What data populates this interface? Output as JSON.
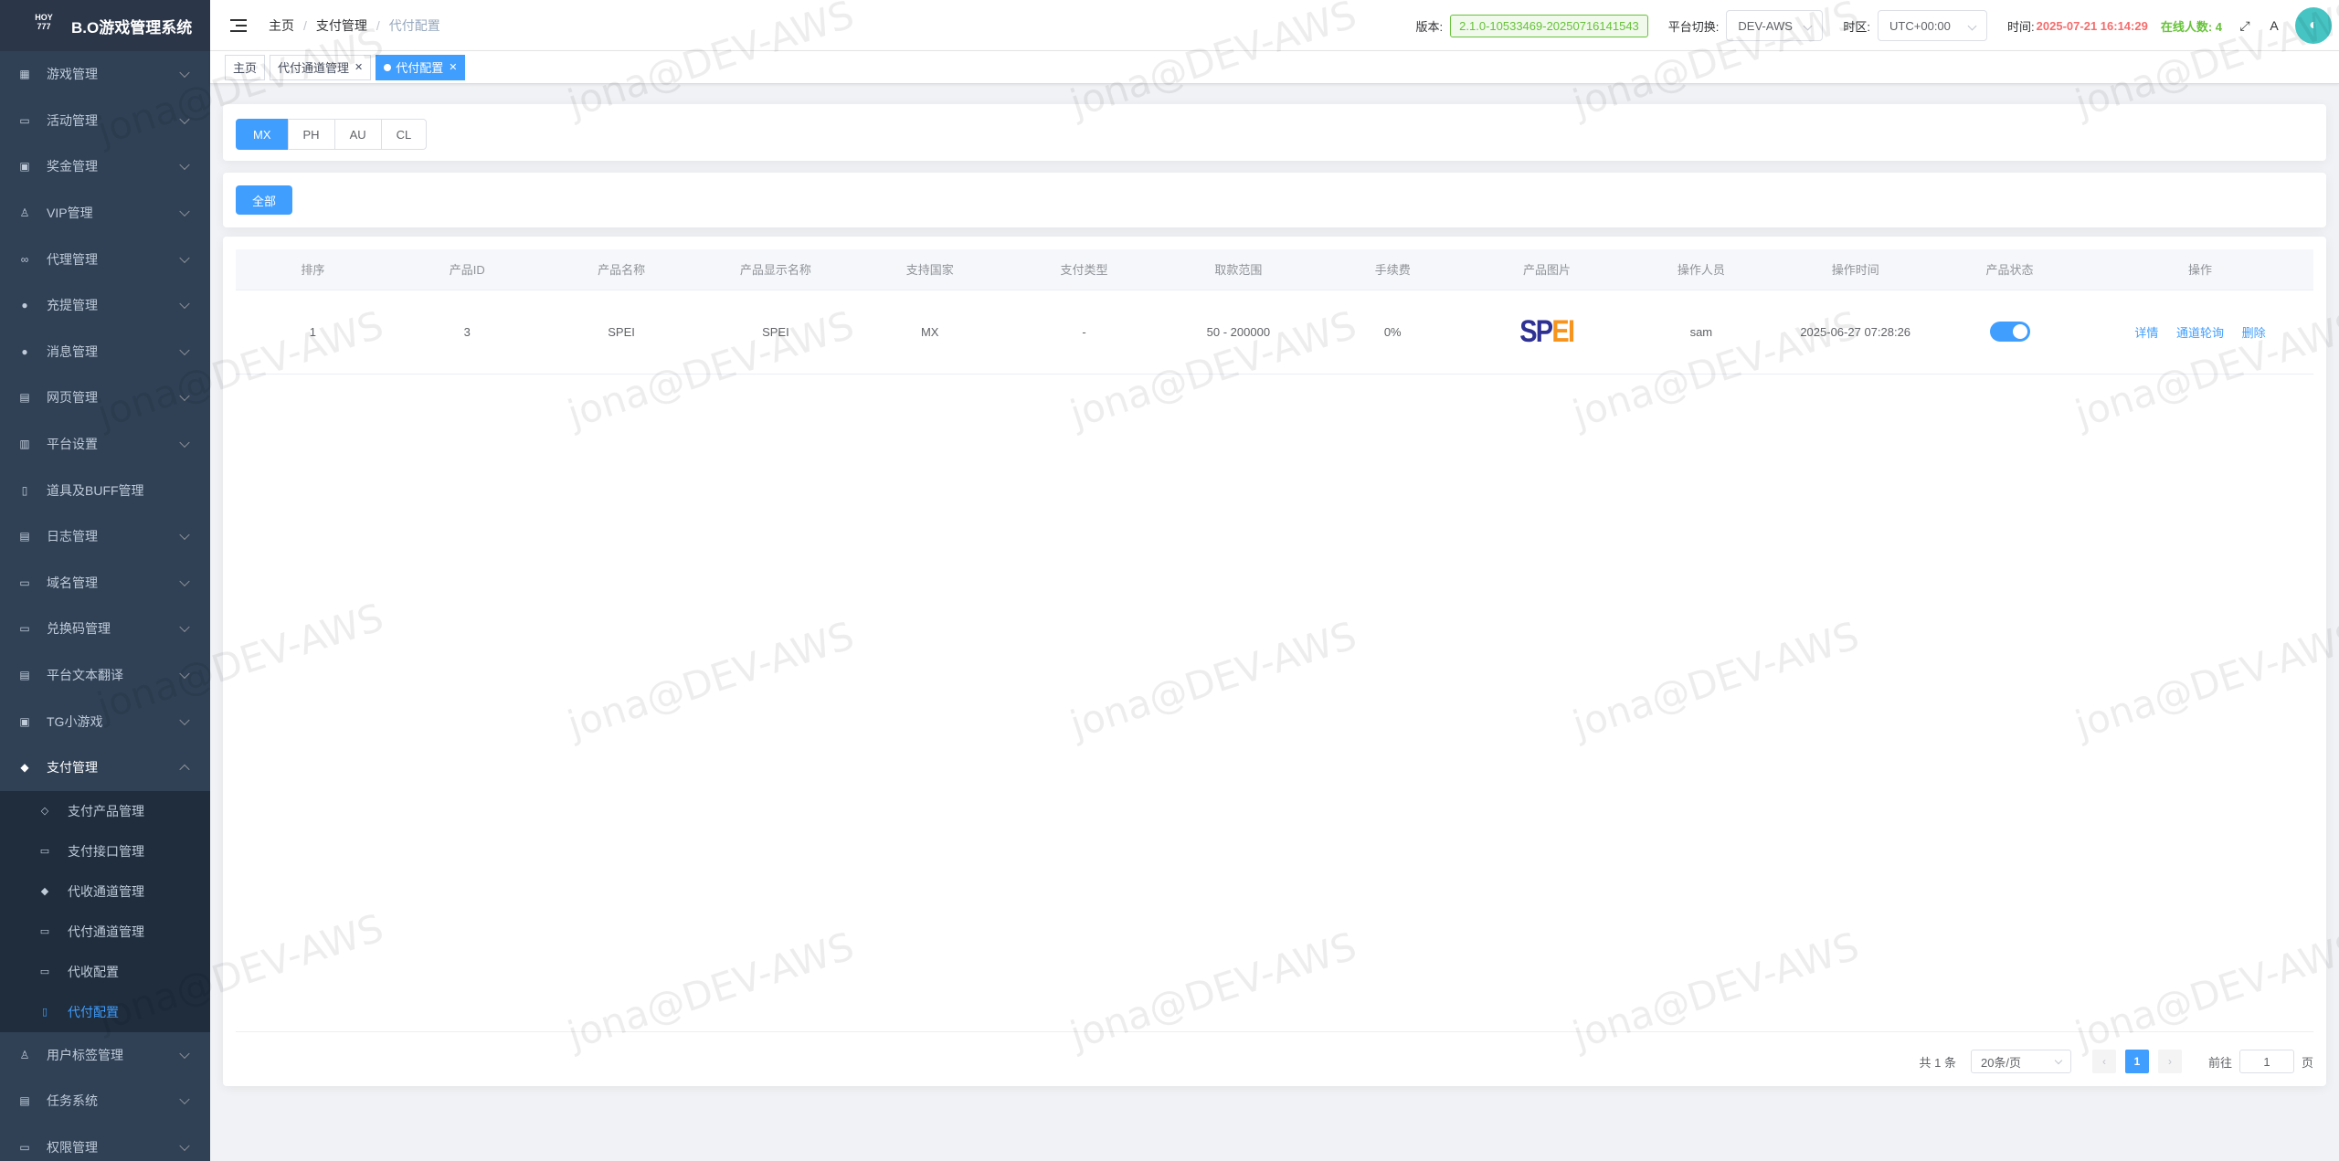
{
  "app": {
    "logo_text": "HOY 777",
    "title": "B.O游戏管理系统"
  },
  "sidebar": {
    "items": [
      {
        "label": "游戏管理",
        "icon": "grid-icon"
      },
      {
        "label": "活动管理",
        "icon": "calendar-icon"
      },
      {
        "label": "奖金管理",
        "icon": "money-icon"
      },
      {
        "label": "VIP管理",
        "icon": "vip-icon"
      },
      {
        "label": "代理管理",
        "icon": "link-icon"
      },
      {
        "label": "充提管理",
        "icon": "wallet-icon"
      },
      {
        "label": "消息管理",
        "icon": "message-icon"
      },
      {
        "label": "网页管理",
        "icon": "webpage-icon"
      },
      {
        "label": "平台设置",
        "icon": "platform-icon"
      },
      {
        "label": "道具及BUFF管理",
        "icon": "item-icon"
      },
      {
        "label": "日志管理",
        "icon": "log-icon"
      },
      {
        "label": "域名管理",
        "icon": "monitor-icon"
      },
      {
        "label": "兑换码管理",
        "icon": "code-icon"
      },
      {
        "label": "平台文本翻译",
        "icon": "translate-icon"
      },
      {
        "label": "TG小游戏",
        "icon": "tg-icon"
      },
      {
        "label": "支付管理",
        "icon": "payment-icon"
      }
    ],
    "payment_sub": [
      {
        "label": "支付产品管理",
        "icon": "shield-icon"
      },
      {
        "label": "支付接口管理",
        "icon": "interface-icon"
      },
      {
        "label": "代收通道管理",
        "icon": "layers-icon"
      },
      {
        "label": "代付通道管理",
        "icon": "channel-icon"
      },
      {
        "label": "代收配置",
        "icon": "config-icon"
      },
      {
        "label": "代付配置",
        "icon": "document-icon"
      }
    ],
    "items_after": [
      {
        "label": "用户标签管理",
        "icon": "user-icon"
      },
      {
        "label": "任务系统",
        "icon": "task-icon"
      },
      {
        "label": "权限管理",
        "icon": "permission-icon"
      }
    ]
  },
  "navbar": {
    "breadcrumb": [
      "主页",
      "支付管理",
      "代付配置"
    ],
    "version_label": "版本:",
    "version_value": "2.1.0-10533469-20250716141543",
    "platform_label": "平台切换:",
    "platform_value": "DEV-AWS",
    "timezone_label": "时区:",
    "timezone_value": "UTC+00:00",
    "time_label": "时间:",
    "time_value": "2025-07-21 16:14:29",
    "online_label": "在线人数: 4"
  },
  "tags": [
    {
      "label": "主页"
    },
    {
      "label": "代付通道管理"
    },
    {
      "label": "代付配置"
    }
  ],
  "region_tabs": [
    "MX",
    "PH",
    "AU",
    "CL"
  ],
  "filter": {
    "all_label": "全部"
  },
  "table": {
    "headers": [
      "排序",
      "产品ID",
      "产品名称",
      "产品显示名称",
      "支持国家",
      "支付类型",
      "取款范围",
      "手续费",
      "产品图片",
      "操作人员",
      "操作时间",
      "产品状态",
      "操作"
    ],
    "rows": [
      {
        "order": "1",
        "product_id": "3",
        "name": "SPEI",
        "display_name": "SPEI",
        "country": "MX",
        "pay_type": "-",
        "range": "50 - 200000",
        "fee": "0%",
        "image_logo_a": "SP",
        "image_logo_b": "EI",
        "operator": "sam",
        "time": "2025-06-27 07:28:26",
        "status_on": true,
        "actions": [
          "详情",
          "通道轮询",
          "删除"
        ]
      }
    ]
  },
  "pagination": {
    "total": "共 1 条",
    "page_size": "20条/页",
    "current": "1",
    "goto_label": "前往",
    "goto_value": "1",
    "page_unit": "页"
  },
  "watermark": "jona@DEV-AWS",
  "colors": {
    "primary": "#409eff",
    "sidebar_bg": "#304156",
    "time_red": "#f56c6c",
    "online_green": "#67c23a"
  }
}
